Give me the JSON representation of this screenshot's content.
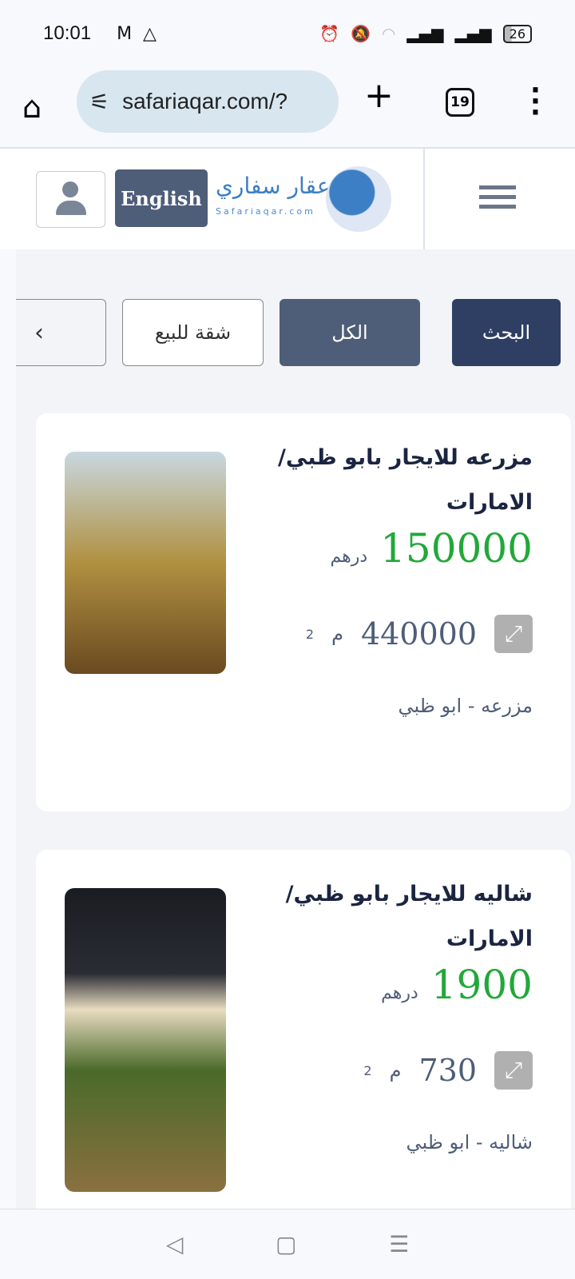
{
  "status": {
    "time": "10:01",
    "battery": "26"
  },
  "browser": {
    "url": "safariaqar.com/?",
    "tab_count": "19"
  },
  "header": {
    "logo_ar": "عقار سفاري",
    "logo_en": "Safariaqar.com",
    "language_button": "English"
  },
  "filters": [
    {
      "label": "البحث"
    },
    {
      "label": "الكل"
    },
    {
      "label": "شقة للبيع"
    }
  ],
  "listings": [
    {
      "title": "مزرعه للايجار بابو ظبي/ الامارات",
      "price": "150000",
      "currency": "درهم",
      "area": "440000",
      "area_unit": "م",
      "area_sup": "2",
      "location": "مزرعه - ابو ظبي"
    },
    {
      "title": "شاليه للايجار بابو ظبي/ الامارات",
      "price": "1900",
      "currency": "درهم",
      "area": "730",
      "area_unit": "م",
      "area_sup": "2",
      "location": "شاليه - ابو ظبي"
    }
  ],
  "colors": {
    "price": "#22a83a",
    "primary": "#2f3f63",
    "secondary": "#4e5d78"
  }
}
